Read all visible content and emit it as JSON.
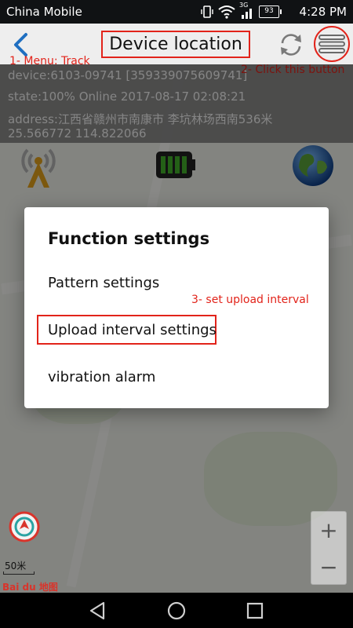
{
  "status_bar": {
    "carrier": "China Mobile",
    "network": "3G",
    "battery": "93",
    "time": "4:28 PM"
  },
  "header": {
    "title": "Device location",
    "back_icon": "chevron-left-icon",
    "refresh_icon": "refresh-icon",
    "menu_icon": "menu-icon"
  },
  "info": {
    "device": "device:6103-09741 [359339075609741]",
    "state": "state:100%  Online  2017-08-17 02:08:21",
    "address": "address:江西省赣州市南康市 李坑林场西南536米",
    "coordinates": "25.566772 114.822066"
  },
  "annotations": {
    "step1": "1- Menu: Track",
    "step2": "2- Click this button",
    "step3": "3- set upload interval"
  },
  "dialog": {
    "title": "Function settings",
    "items": [
      {
        "label": "Pattern settings"
      },
      {
        "label": "Upload interval settings"
      },
      {
        "label": "vibration alarm"
      }
    ]
  },
  "map": {
    "zoom_in": "+",
    "zoom_out": "−",
    "scale": "50米",
    "logo": "Bai du 地图"
  },
  "colors": {
    "annotation_red": "#e2231a",
    "status_bar": "#101214",
    "battery_green": "#43b02a"
  }
}
